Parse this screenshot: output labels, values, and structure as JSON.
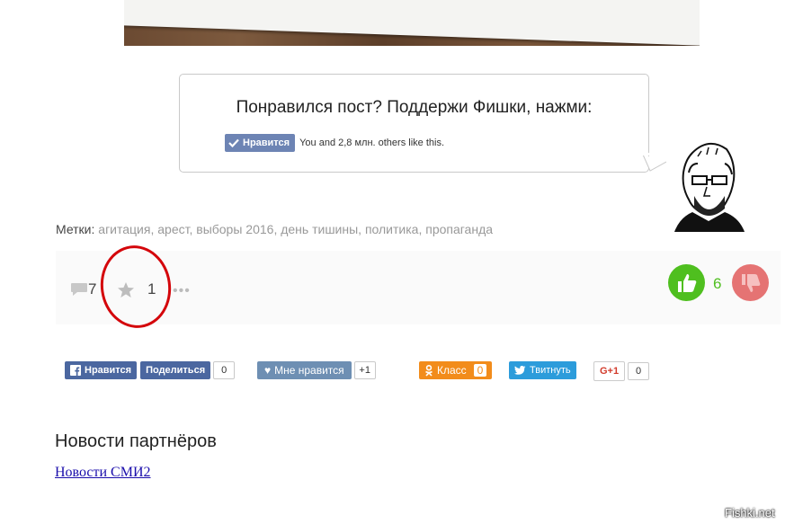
{
  "bubble": {
    "title": "Понравился пост? Поддержи Фишки, нажми:",
    "fb_like_label": "Нравится",
    "fb_like_text": "You and 2,8 млн. others like this."
  },
  "tags": {
    "label": "Метки:",
    "items": [
      "агитация",
      "арест",
      "выборы 2016",
      "день тишины",
      "политика",
      "пропаганда"
    ]
  },
  "stats": {
    "comments": "7",
    "favorites": "1",
    "likes": "6"
  },
  "share": {
    "fb_like": "Нравится",
    "fb_share": "Поделиться",
    "fb_count": "0",
    "vk_like": "Мне нравится",
    "vk_count": "+1",
    "ok_label": "Класс",
    "ok_count": "0",
    "tw_label": "Твитнуть",
    "gp_label": "G+1",
    "gp_count": "0"
  },
  "partners": {
    "title": "Новости партнёров",
    "link": "Новости СМИ2"
  },
  "watermark": "Fishki.net",
  "colors": {
    "like_green": "#4fbf1f",
    "dislike_red": "#e57373",
    "annotation_red": "#d4060b",
    "fb_blue": "#4b67a0"
  }
}
